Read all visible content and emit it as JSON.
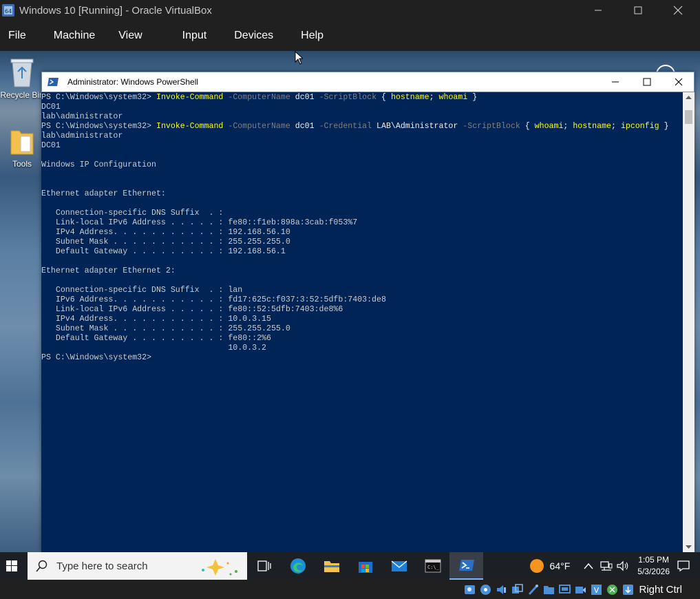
{
  "vbox": {
    "title": "Windows 10 [Running] - Oracle VirtualBox",
    "menu": [
      "File",
      "Machine",
      "View",
      "Input",
      "Devices",
      "Help"
    ],
    "host_key": "Right Ctrl"
  },
  "desktop": {
    "icons": [
      {
        "label": "Recycle Bin",
        "icon": "recycle-bin-icon"
      },
      {
        "label": "Tools",
        "icon": "folder-icon"
      }
    ]
  },
  "powershell": {
    "title": "Administrator: Windows PowerShell",
    "lines": [
      {
        "type": "cmd",
        "prompt": "PS C:\\Windows\\system32> ",
        "tokens": [
          {
            "t": "Invoke-Command",
            "c": "cmd"
          },
          {
            "t": " ",
            "c": ""
          },
          {
            "t": "-ComputerName",
            "c": "param"
          },
          {
            "t": " dc01 ",
            "c": "arg"
          },
          {
            "t": "-ScriptBlock",
            "c": "param"
          },
          {
            "t": " { ",
            "c": "arg"
          },
          {
            "t": "hostname",
            "c": "cmd"
          },
          {
            "t": "; ",
            "c": "arg"
          },
          {
            "t": "whoami",
            "c": "cmd"
          },
          {
            "t": " }",
            "c": "arg"
          }
        ]
      },
      {
        "type": "out",
        "text": "DC01"
      },
      {
        "type": "out",
        "text": "lab\\administrator"
      },
      {
        "type": "cmd",
        "prompt": "PS C:\\Windows\\system32> ",
        "tokens": [
          {
            "t": "Invoke-Command",
            "c": "cmd"
          },
          {
            "t": " ",
            "c": ""
          },
          {
            "t": "-ComputerName",
            "c": "param"
          },
          {
            "t": " dc01 ",
            "c": "arg"
          },
          {
            "t": "-Credential",
            "c": "param"
          },
          {
            "t": " LAB\\Administrator ",
            "c": "arg"
          },
          {
            "t": "-ScriptBlock",
            "c": "param"
          },
          {
            "t": " { ",
            "c": "arg"
          },
          {
            "t": "whoami",
            "c": "cmd"
          },
          {
            "t": "; ",
            "c": "arg"
          },
          {
            "t": "hostname",
            "c": "cmd"
          },
          {
            "t": "; ",
            "c": "arg"
          },
          {
            "t": "ipconfig",
            "c": "cmd"
          },
          {
            "t": " }",
            "c": "arg"
          }
        ]
      },
      {
        "type": "out",
        "text": "lab\\administrator"
      },
      {
        "type": "out",
        "text": "DC01"
      },
      {
        "type": "out",
        "text": ""
      },
      {
        "type": "out",
        "text": "Windows IP Configuration"
      },
      {
        "type": "out",
        "text": ""
      },
      {
        "type": "out",
        "text": ""
      },
      {
        "type": "out",
        "text": "Ethernet adapter Ethernet:"
      },
      {
        "type": "out",
        "text": ""
      },
      {
        "type": "out",
        "text": "   Connection-specific DNS Suffix  . :"
      },
      {
        "type": "out",
        "text": "   Link-local IPv6 Address . . . . . : fe80::f1eb:898a:3cab:f053%7"
      },
      {
        "type": "out",
        "text": "   IPv4 Address. . . . . . . . . . . : 192.168.56.10"
      },
      {
        "type": "out",
        "text": "   Subnet Mask . . . . . . . . . . . : 255.255.255.0"
      },
      {
        "type": "out",
        "text": "   Default Gateway . . . . . . . . . : 192.168.56.1"
      },
      {
        "type": "out",
        "text": ""
      },
      {
        "type": "out",
        "text": "Ethernet adapter Ethernet 2:"
      },
      {
        "type": "out",
        "text": ""
      },
      {
        "type": "out",
        "text": "   Connection-specific DNS Suffix  . : lan"
      },
      {
        "type": "out",
        "text": "   IPv6 Address. . . . . . . . . . . : fd17:625c:f037:3:52:5dfb:7403:de8"
      },
      {
        "type": "out",
        "text": "   Link-local IPv6 Address . . . . . : fe80::52:5dfb:7403:de8%6"
      },
      {
        "type": "out",
        "text": "   IPv4 Address. . . . . . . . . . . : 10.0.3.15"
      },
      {
        "type": "out",
        "text": "   Subnet Mask . . . . . . . . . . . : 255.255.255.0"
      },
      {
        "type": "out",
        "text": "   Default Gateway . . . . . . . . . : fe80::2%6"
      },
      {
        "type": "out",
        "text": "                                       10.0.3.2"
      },
      {
        "type": "out",
        "text": "PS C:\\Windows\\system32>"
      }
    ]
  },
  "taskbar": {
    "search_placeholder": "Type here to search",
    "apps": [
      "task-view-icon",
      "edge-icon",
      "file-explorer-icon",
      "store-icon",
      "mail-icon",
      "terminal-icon",
      "powershell-icon"
    ],
    "weather": "64°F",
    "time": "1:05 PM",
    "date": "5/3/2026"
  },
  "colors": {
    "ps_background": "#012456",
    "ps_command": "#ffff00",
    "ps_parameter": "#808080",
    "ps_text": "#cccccc"
  }
}
